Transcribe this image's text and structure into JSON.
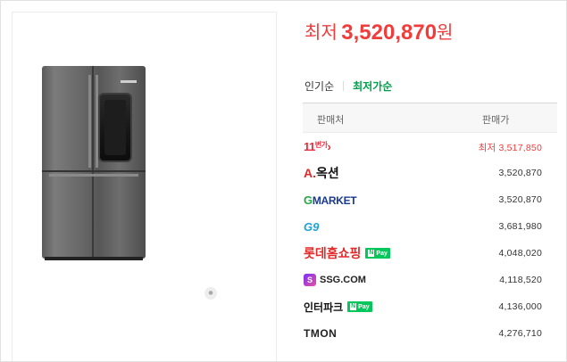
{
  "price_header": {
    "label": "최저",
    "value": "3,520,870",
    "unit": "원"
  },
  "tabs": [
    {
      "label": "인기순",
      "active": false
    },
    {
      "label": "최저가순",
      "active": true
    }
  ],
  "table": {
    "headers": {
      "seller": "판매처",
      "price": "판매가"
    },
    "rows": [
      {
        "seller": "11번가",
        "logo_main": "11",
        "logo_sub": "번가",
        "amount": "최저 3,517,850",
        "lowest": true,
        "npay": false
      },
      {
        "seller": "옥션",
        "logo_main": "A.",
        "logo_sub": "옥션",
        "amount": "3,520,870",
        "lowest": false,
        "npay": false
      },
      {
        "seller": "Gmarket",
        "logo_main": "G",
        "logo_sub": "MARKET",
        "amount": "3,520,870",
        "lowest": false,
        "npay": false
      },
      {
        "seller": "G9",
        "logo_main": "G9",
        "amount": "3,681,980",
        "lowest": false,
        "npay": false
      },
      {
        "seller": "롯데홈쇼핑",
        "logo_main": "롯데홈쇼핑",
        "amount": "4,048,020",
        "lowest": false,
        "npay": true
      },
      {
        "seller": "SSG.COM",
        "logo_main": "SSG.COM",
        "logo_mark": "S",
        "amount": "4,118,520",
        "lowest": false,
        "npay": false
      },
      {
        "seller": "인터파크",
        "logo_main": "인터파크",
        "amount": "4,136,000",
        "lowest": false,
        "npay": true
      },
      {
        "seller": "TMON",
        "logo_main": "TMON",
        "amount": "4,276,710",
        "lowest": false,
        "npay": false
      }
    ]
  },
  "npay_badge": {
    "n": "N",
    "text": "Pay"
  },
  "colors": {
    "accent_red": "#f13c3c",
    "accent_green": "#00a04b",
    "npay_green": "#03c75a"
  },
  "icons": [
    "refrigerator-product-image",
    "energy-badge-icon",
    "npay-badge-icon"
  ]
}
